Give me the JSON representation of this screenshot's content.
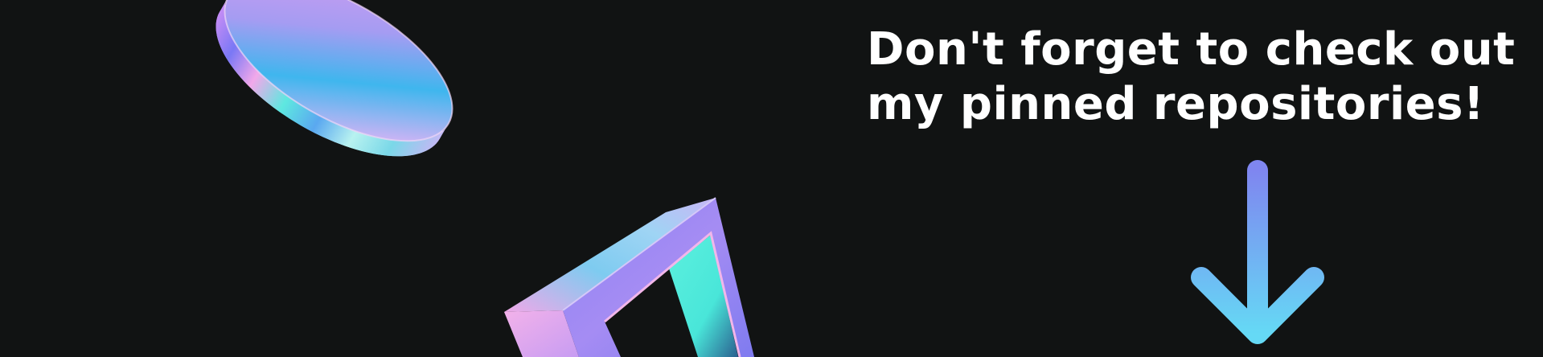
{
  "banner": {
    "headline_line1": "Don't forget to check out",
    "headline_line2": "my pinned repositories!",
    "background_color": "#111313"
  },
  "decorations": {
    "disc": "holographic-disc",
    "frame": "holographic-frame",
    "arrow": "down-arrow-icon"
  },
  "colors": {
    "holo_pink": "#f2a8e6",
    "holo_purple": "#b78cf0",
    "holo_blue": "#39b8ee",
    "holo_cyan": "#6cf0e2",
    "arrow_top": "#7f86f0",
    "arrow_bottom": "#65d9f5"
  }
}
